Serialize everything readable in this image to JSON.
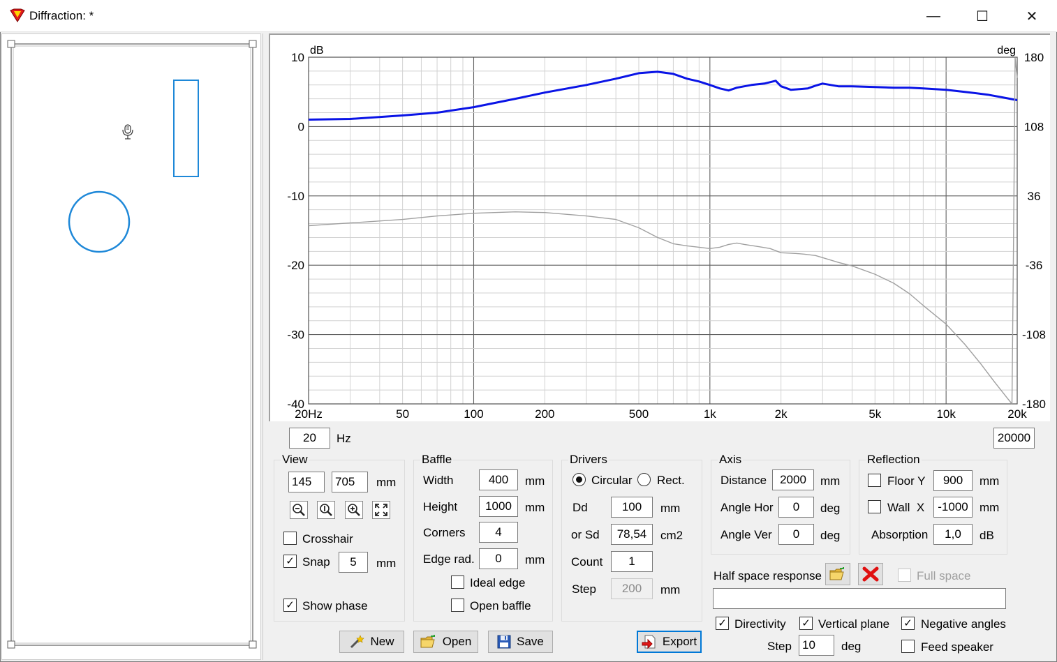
{
  "window": {
    "title": "Diffraction: *",
    "minimize_glyph": "—",
    "maximize_glyph": "☐",
    "close_glyph": "✕"
  },
  "plot": {
    "y_unit": "dB",
    "y2_unit": "deg",
    "y_ticks": [
      "10",
      "0",
      "-10",
      "-20",
      "-30",
      "-40"
    ],
    "y2_ticks": [
      "180",
      "108",
      "36",
      "-36",
      "-108",
      "-180"
    ],
    "x_ticks": [
      {
        "f": 20,
        "label": "20Hz"
      },
      {
        "f": 50,
        "label": "50"
      },
      {
        "f": 100,
        "label": "100"
      },
      {
        "f": 200,
        "label": "200"
      },
      {
        "f": 500,
        "label": "500"
      },
      {
        "f": 1000,
        "label": "1k"
      },
      {
        "f": 2000,
        "label": "2k"
      },
      {
        "f": 5000,
        "label": "5k"
      },
      {
        "f": 10000,
        "label": "10k"
      },
      {
        "f": 20000,
        "label": "20k"
      }
    ],
    "freq_min": "20",
    "freq_unit": "Hz",
    "freq_max": "20000"
  },
  "chart_data": {
    "type": "line",
    "xlabel": "",
    "ylabel": "dB",
    "y2label": "deg",
    "xscale": "log",
    "xlim": [
      20,
      20000
    ],
    "ylim": [
      -40,
      10
    ],
    "y2lim": [
      -180,
      180
    ],
    "grid": true,
    "series": [
      {
        "color": "#0a14e6",
        "axis": "left",
        "points": [
          [
            20,
            1.0
          ],
          [
            30,
            1.1
          ],
          [
            50,
            1.6
          ],
          [
            70,
            2.0
          ],
          [
            100,
            2.8
          ],
          [
            150,
            4.0
          ],
          [
            200,
            4.9
          ],
          [
            300,
            6.0
          ],
          [
            400,
            6.9
          ],
          [
            500,
            7.7
          ],
          [
            600,
            7.9
          ],
          [
            700,
            7.6
          ],
          [
            800,
            6.9
          ],
          [
            900,
            6.5
          ],
          [
            1000,
            6.0
          ],
          [
            1100,
            5.5
          ],
          [
            1200,
            5.2
          ],
          [
            1300,
            5.6
          ],
          [
            1500,
            6.0
          ],
          [
            1700,
            6.2
          ],
          [
            1900,
            6.6
          ],
          [
            2000,
            5.8
          ],
          [
            2200,
            5.3
          ],
          [
            2400,
            5.4
          ],
          [
            2600,
            5.5
          ],
          [
            2800,
            5.9
          ],
          [
            3000,
            6.2
          ],
          [
            3500,
            5.8
          ],
          [
            4000,
            5.8
          ],
          [
            5000,
            5.7
          ],
          [
            6000,
            5.6
          ],
          [
            7000,
            5.6
          ],
          [
            8000,
            5.5
          ],
          [
            10000,
            5.3
          ],
          [
            12000,
            5.0
          ],
          [
            15000,
            4.6
          ],
          [
            18000,
            4.1
          ],
          [
            20000,
            3.8
          ]
        ]
      },
      {
        "color": "#a0a0a0",
        "axis": "left",
        "points": [
          [
            20,
            -14.3
          ],
          [
            30,
            -13.9
          ],
          [
            50,
            -13.4
          ],
          [
            70,
            -12.9
          ],
          [
            100,
            -12.5
          ],
          [
            150,
            -12.3
          ],
          [
            200,
            -12.4
          ],
          [
            300,
            -12.9
          ],
          [
            400,
            -13.4
          ],
          [
            500,
            -14.6
          ],
          [
            600,
            -16.0
          ],
          [
            700,
            -16.9
          ],
          [
            800,
            -17.2
          ],
          [
            900,
            -17.4
          ],
          [
            1000,
            -17.6
          ],
          [
            1100,
            -17.4
          ],
          [
            1200,
            -17.0
          ],
          [
            1300,
            -16.8
          ],
          [
            1400,
            -17.0
          ],
          [
            1600,
            -17.3
          ],
          [
            1800,
            -17.6
          ],
          [
            2000,
            -18.2
          ],
          [
            2300,
            -18.3
          ],
          [
            2500,
            -18.4
          ],
          [
            2800,
            -18.6
          ],
          [
            3000,
            -18.9
          ],
          [
            3500,
            -19.6
          ],
          [
            4000,
            -20.1
          ],
          [
            5000,
            -21.3
          ],
          [
            6000,
            -22.6
          ],
          [
            7000,
            -24.1
          ],
          [
            8000,
            -25.8
          ],
          [
            10000,
            -28.5
          ],
          [
            12000,
            -31.4
          ],
          [
            14000,
            -34.2
          ],
          [
            16000,
            -36.8
          ],
          [
            18000,
            -39.0
          ],
          [
            19000,
            -40.0
          ]
        ]
      },
      {
        "color": "#a0a0a0",
        "axis": "left",
        "points": [
          [
            19000,
            -40.0
          ],
          [
            19300,
            -16.0
          ],
          [
            19600,
            9.9
          ],
          [
            20000,
            7.0
          ]
        ]
      }
    ]
  },
  "view": {
    "title": "View",
    "v1": "145",
    "v2": "705",
    "unit": "mm",
    "crosshair_label": "Crosshair",
    "crosshair": false,
    "snap_label": "Snap",
    "snap": true,
    "snap_value": "5",
    "snap_unit": "mm",
    "show_phase_label": "Show phase",
    "show_phase": true
  },
  "baffle": {
    "title": "Baffle",
    "width_label": "Width",
    "width": "400",
    "width_unit": "mm",
    "height_label": "Height",
    "height": "1000",
    "height_unit": "mm",
    "corners_label": "Corners",
    "corners": "4",
    "edge_label": "Edge rad.",
    "edge": "0",
    "edge_unit": "mm",
    "ideal_edge_label": "Ideal edge",
    "ideal_edge": false,
    "open_baffle_label": "Open baffle",
    "open_baffle": false
  },
  "drivers": {
    "title": "Drivers",
    "circular_label": "Circular",
    "rect_label": "Rect.",
    "dd_label": "Dd",
    "dd": "100",
    "dd_unit": "mm",
    "sd_label": "or Sd",
    "sd": "78,54",
    "sd_unit": "cm2",
    "count_label": "Count",
    "count": "1",
    "step_label": "Step",
    "step": "200",
    "step_unit": "mm"
  },
  "axis": {
    "title": "Axis",
    "distance_label": "Distance",
    "distance": "2000",
    "distance_unit": "mm",
    "hor_label": "Angle Hor",
    "hor": "0",
    "hor_unit": "deg",
    "ver_label": "Angle Ver",
    "ver": "0",
    "ver_unit": "deg"
  },
  "reflection": {
    "title": "Reflection",
    "floor_label": "Floor Y",
    "floor": "900",
    "floor_unit": "mm",
    "wall_label": "Wall  X",
    "wall": "-1000",
    "wall_unit": "mm",
    "absorption_label": "Absorption",
    "absorption": "1,0",
    "absorption_unit": "dB"
  },
  "half_space": {
    "label": "Half space response",
    "full_space_label": "Full space",
    "path": ""
  },
  "options": {
    "directivity_label": "Directivity",
    "vertical_label": "Vertical plane",
    "negative_label": "Negative angles",
    "step_label": "Step",
    "step": "10",
    "step_unit": "deg",
    "feed_label": "Feed speaker"
  },
  "buttons": {
    "new": "New",
    "open": "Open",
    "save": "Save",
    "export": "Export"
  },
  "colors": {
    "accent": "#0078d7",
    "driver_outline": "#1e88d8",
    "response": "#0a14e6",
    "phase": "#a0a0a0"
  }
}
